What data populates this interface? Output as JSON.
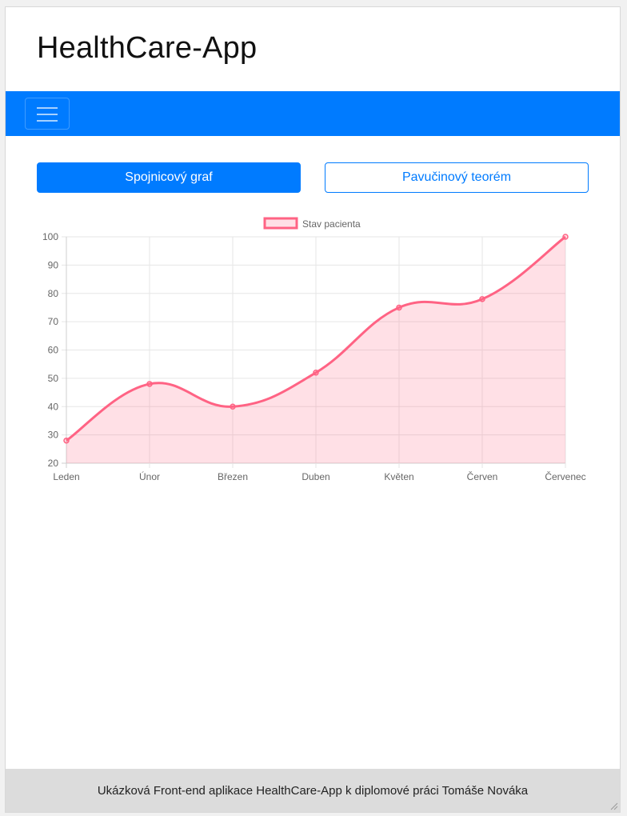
{
  "app": {
    "title": "HealthCare-App"
  },
  "navbar": {
    "toggle_icon": "hamburger-menu-icon",
    "background": "#007bff"
  },
  "buttons": {
    "line_chart": "Spojnicový graf",
    "cobweb": "Pavučinový teorém"
  },
  "chart_data": {
    "type": "line",
    "categories": [
      "Leden",
      "Únor",
      "Březen",
      "Duben",
      "Květen",
      "Červen",
      "Červenec"
    ],
    "series": [
      {
        "name": "Stav pacienta",
        "values": [
          28,
          48,
          40,
          52,
          75,
          78,
          100
        ],
        "color": "#ff6384",
        "fill": "rgba(255,99,132,0.2)"
      }
    ],
    "ylim": [
      20,
      100
    ],
    "yticks": [
      20,
      30,
      40,
      50,
      60,
      70,
      80,
      90,
      100
    ],
    "grid": true,
    "legend": "top-center",
    "smooth": true,
    "area_fill": true
  },
  "footer": {
    "text": "Ukázková Front-end aplikace HealthCare-App k diplomové práci Tomáše Nováka"
  }
}
